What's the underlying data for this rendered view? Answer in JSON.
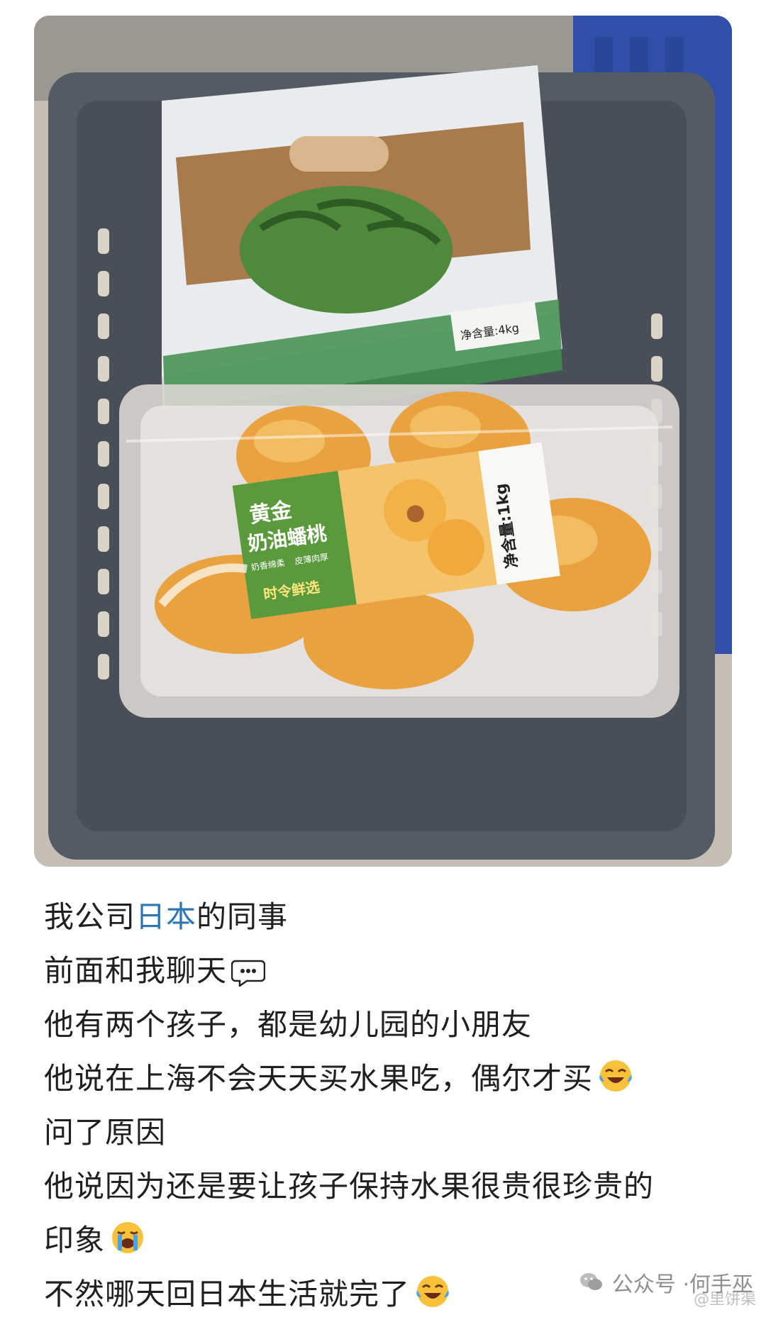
{
  "post": {
    "photo_alt": "购物篮里的西瓜和黄金奶油蟠桃",
    "product_label": {
      "title_line1": "黄金",
      "title_line2": "奶油蟠桃",
      "subtitle_left": "奶香绵柔",
      "subtitle_right": "皮薄肉厚",
      "brand": "时令鲜选",
      "net_weight": "净含量:1kg"
    },
    "watermelon_label": {
      "net_weight": "净含量:4kg"
    },
    "lines": [
      {
        "before": "我公司",
        "link": "日本",
        "after": "的同事",
        "emoji": ""
      },
      {
        "before": "前面和我聊天",
        "link": "",
        "after": "",
        "emoji": "speech-bubble-icon"
      },
      {
        "before": "他有两个孩子，都是幼儿园的小朋友",
        "link": "",
        "after": "",
        "emoji": ""
      },
      {
        "before": "他说在上海不会天天买水果吃，偶尔才买",
        "link": "",
        "after": "",
        "emoji": "tears-of-joy-icon"
      },
      {
        "before": "问了原因",
        "link": "",
        "after": "",
        "emoji": ""
      },
      {
        "before": "他说因为还是要让孩子保持水果很贵很珍贵的",
        "link": "",
        "after": "",
        "emoji": ""
      },
      {
        "before": "印象",
        "link": "",
        "after": "",
        "emoji": "loudly-crying-icon"
      },
      {
        "before": "不然哪天回日本生活就完了",
        "link": "",
        "after": "",
        "emoji": "tears-of-joy-icon"
      }
    ],
    "footer": {
      "account_prefix": "公众号 · ",
      "account_name": "何手巫",
      "watermark": "@里饼渠"
    }
  },
  "colors": {
    "link": "#2f76b7",
    "text": "#1f1f1f",
    "label_green": "#5a9a3d"
  }
}
